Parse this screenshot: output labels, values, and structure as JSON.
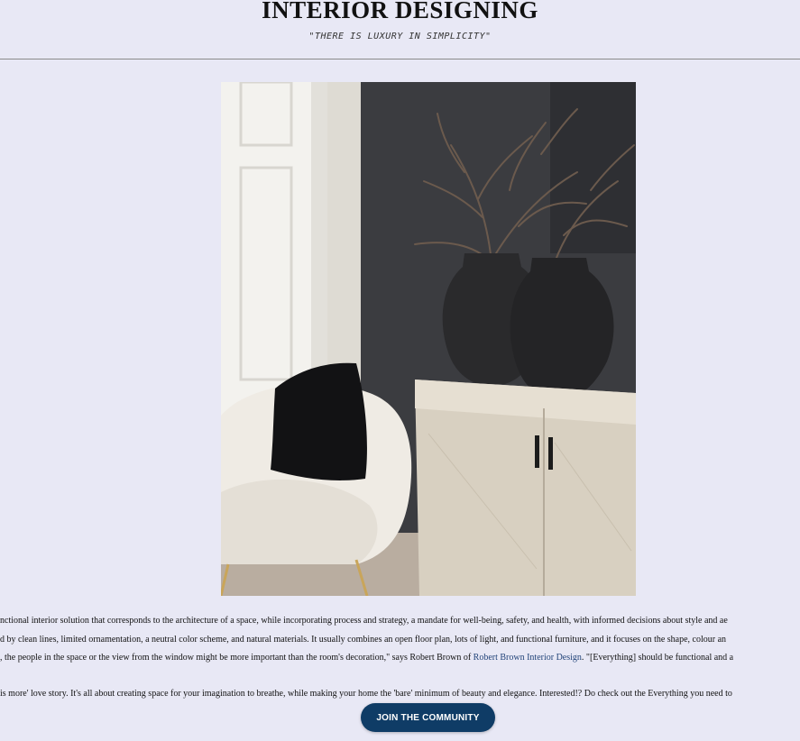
{
  "header": {
    "title": "INTERIOR DESIGNING",
    "tagline": "\"THERE IS LUXURY IN SIMPLICITY\""
  },
  "hero": {
    "description_icon": "photo-of-interior"
  },
  "article": {
    "line1": "nctional interior solution that corresponds to the architecture of a space, while incorporating process and strategy, a mandate for well-being, safety, and health, with informed decisions about style and ae",
    "line2": "d by clean lines, limited ornamentation, a neutral color scheme, and natural materials. It usually combines an open floor plan, lots of light, and functional furniture, and it focuses on the shape, colour an",
    "line3_pre": ", the people in the space or the view from the window might be more important than the room's decoration,\" says Robert Brown of ",
    "line3_link": "Robert Brown Interior Design",
    "line3_post": ". \"[Everything] should be functional and a",
    "line4": "is more' love story. It's all about creating space for your imagination to breathe, while making your home the 'bare' minimum of beauty and elegance. Interested!? Do check out the Everything you need to"
  },
  "cta": {
    "label": "JOIN THE COMMUNITY"
  },
  "colors": {
    "background": "#e8e8f5",
    "button": "#0f3c66",
    "link": "#24457a"
  }
}
